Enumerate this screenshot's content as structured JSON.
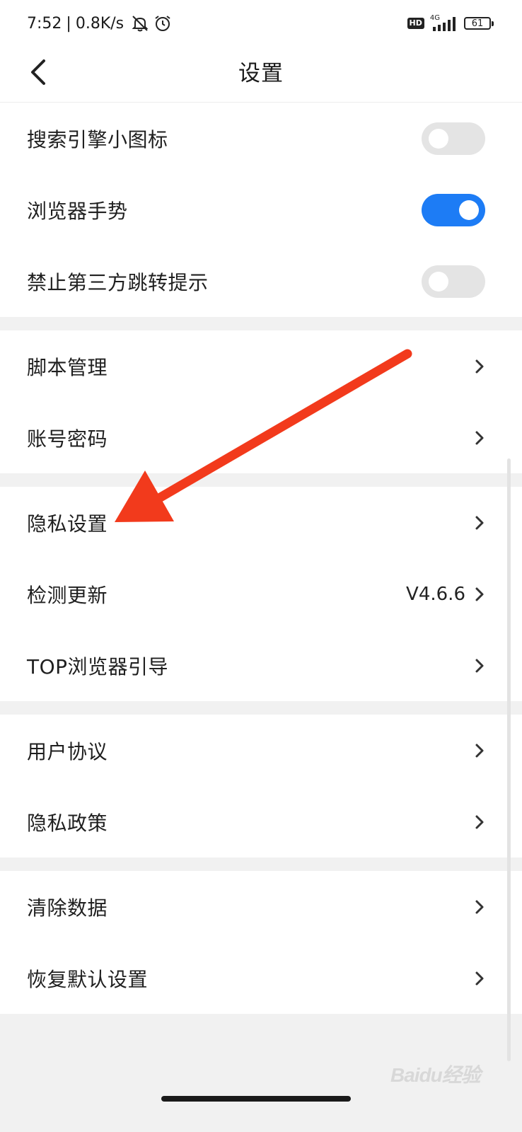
{
  "status_bar": {
    "time": "7:52",
    "separator": "|",
    "net_speed": "0.8K/s",
    "hd_label": "HD",
    "network_type": "4G",
    "battery_level": "61"
  },
  "header": {
    "title": "设置"
  },
  "toggle_section": [
    {
      "label": "搜索引擎小图标",
      "on": false
    },
    {
      "label": "浏览器手势",
      "on": true
    },
    {
      "label": "禁止第三方跳转提示",
      "on": false
    }
  ],
  "section_script": [
    {
      "label": "脚本管理"
    },
    {
      "label": "账号密码"
    }
  ],
  "section_privacy": [
    {
      "label": "隐私设置"
    },
    {
      "label": "检测更新",
      "value": "V4.6.6"
    },
    {
      "label": "TOP浏览器引导"
    }
  ],
  "section_legal": [
    {
      "label": "用户协议"
    },
    {
      "label": "隐私政策"
    }
  ],
  "section_data": [
    {
      "label": "清除数据"
    },
    {
      "label": "恢复默认设置"
    }
  ],
  "watermark": "Baidu经验",
  "colors": {
    "toggle_on": "#1d7cf5",
    "toggle_off": "#e4e4e4",
    "annotation_arrow": "#f23a1c",
    "background": "#f1f1f1"
  }
}
